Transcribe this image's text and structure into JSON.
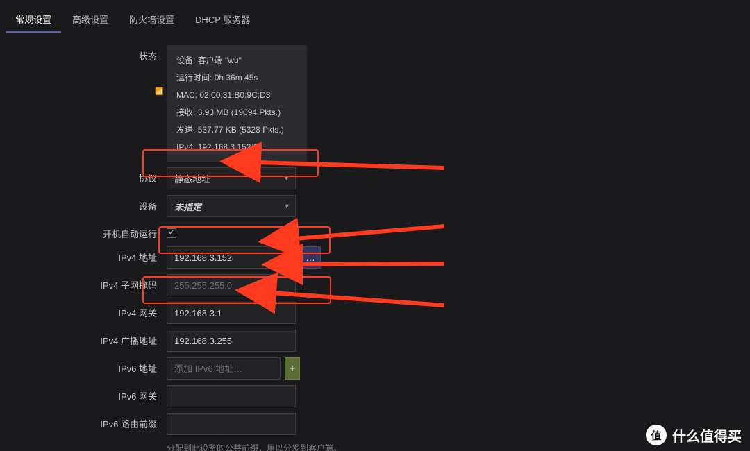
{
  "tabs": {
    "general": "常规设置",
    "advanced": "高级设置",
    "firewall": "防火墙设置",
    "dhcp": "DHCP 服务器"
  },
  "labels": {
    "status": "状态",
    "protocol": "协议",
    "device": "设备",
    "autostart": "开机自动运行",
    "ipv4addr": "IPv4 地址",
    "ipv4mask": "IPv4 子网掩码",
    "ipv4gw": "IPv4 网关",
    "ipv4bcast": "IPv4 广播地址",
    "ipv6addr": "IPv6 地址",
    "ipv6gw": "IPv6 网关",
    "ipv6prefix": "IPv6 路由前缀"
  },
  "status": {
    "device_label": "设备:",
    "device_value": "客户端 \"wu\"",
    "uptime_label": "运行时间:",
    "uptime_value": "0h 36m 45s",
    "mac_label": "MAC:",
    "mac_value": "02:00:31:B0:9C:D3",
    "rx_label": "接收:",
    "rx_value": "3.93 MB (19094 Pkts.)",
    "tx_label": "发送:",
    "tx_value": "537.77 KB (5328 Pkts.)",
    "ipv4_label": "IPv4:",
    "ipv4_value": "192.168.3.152/24"
  },
  "values": {
    "protocol": "静态地址",
    "device": "未指定",
    "ipv4addr": "192.168.3.152",
    "ipv4mask_placeholder": "255.255.255.0",
    "ipv4gw": "192.168.3.1",
    "ipv4bcast": "192.168.3.255",
    "ipv6addr_placeholder": "添加 IPv6 地址…",
    "ipv6prefix_hint": "分配到此设备的公共前缀，用以分发到客户端。",
    "more_btn": "…",
    "add_btn": "+",
    "checkmark": "✓"
  },
  "watermark": {
    "badge": "值",
    "text": "什么值得买"
  },
  "annotations": {
    "highlight_color": "#ff3b1f",
    "highlighted_fields": [
      "protocol",
      "ipv4addr",
      "ipv4gw"
    ]
  }
}
